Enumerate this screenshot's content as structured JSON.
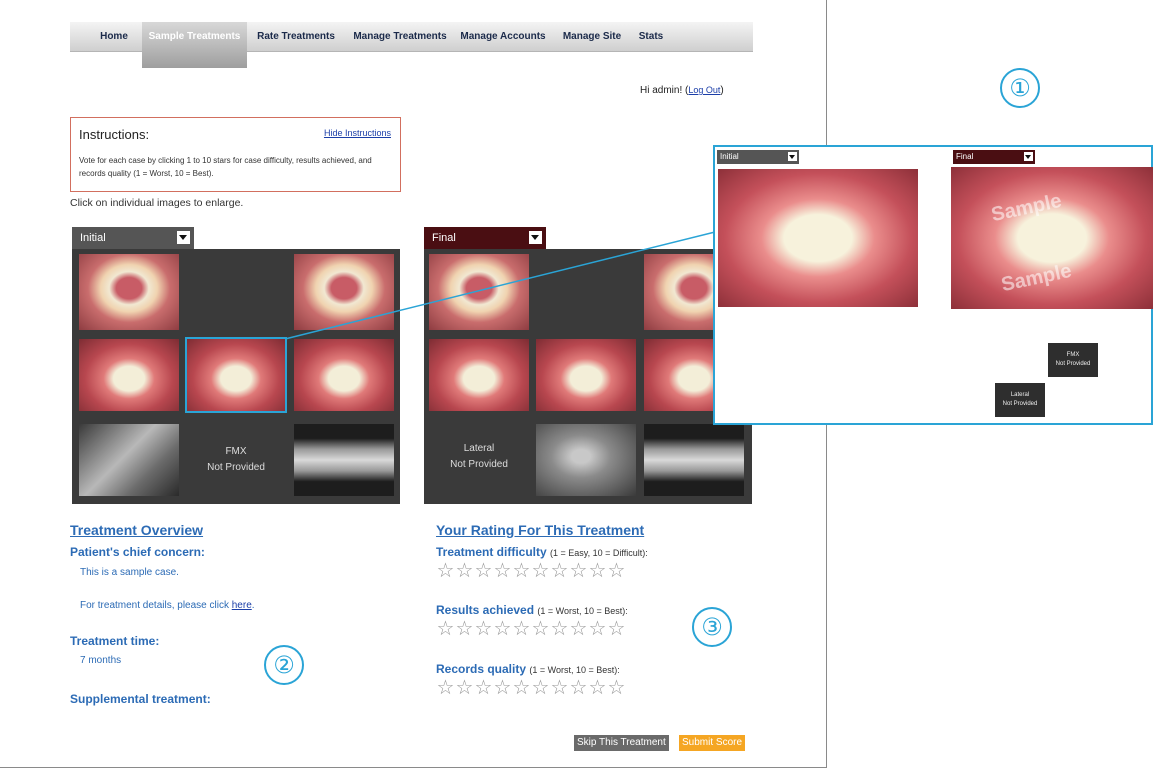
{
  "nav": {
    "items": [
      {
        "label": "Home",
        "active": false
      },
      {
        "label": "Sample Treatments",
        "active": true
      },
      {
        "label": "Rate Treatments",
        "active": false
      },
      {
        "label": "Manage Treatments",
        "active": false
      },
      {
        "label": "Manage Accounts",
        "active": false
      },
      {
        "label": "Manage Site",
        "active": false
      },
      {
        "label": "Stats",
        "active": false
      }
    ]
  },
  "greeting": {
    "text": "Hi admin! (",
    "logout": "Log Out",
    "close": ")"
  },
  "instructions": {
    "title": "Instructions:",
    "hide_link": "Hide Instructions",
    "text": "Vote for each case by clicking 1 to 10 stars for case difficulty, results achieved, and records quality (1 = Worst, 10 = Best)."
  },
  "click_hint": "Click on individual images to enlarge.",
  "panels": {
    "initial": {
      "label": "Initial",
      "color": "#555555",
      "fmx": "FMX",
      "fmx_status": "Not Provided"
    },
    "final": {
      "label": "Final",
      "color": "#4a0e12",
      "lateral": "Lateral",
      "lateral_status": "Not Provided"
    }
  },
  "overview": {
    "heading": "Treatment Overview",
    "concern_label": "Patient's chief concern:",
    "concern_text": "This is a sample case.",
    "details_text": "For treatment details, please click ",
    "details_link": "here",
    "details_end": ".",
    "time_label": "Treatment time:",
    "time_value": "7 months",
    "supplemental_label": "Supplemental treatment:"
  },
  "rating": {
    "heading": "Your Rating For This Treatment",
    "difficulty_label": "Treatment difficulty",
    "difficulty_scale": "(1 = Easy, 10 = Difficult):",
    "results_label": "Results achieved",
    "results_scale": "(1 = Worst, 10 = Best):",
    "records_label": "Records quality",
    "records_scale": "(1 = Worst, 10 = Best):",
    "star_count": 10
  },
  "buttons": {
    "skip": "Skip This Treatment",
    "submit": "Submit Score"
  },
  "callouts": {
    "one": "①",
    "two": "②",
    "three": "③"
  },
  "zoom": {
    "initial_label": "Initial",
    "final_label": "Final",
    "watermark": "Sample",
    "fmx": "FMX",
    "fmx_status": "Not Provided",
    "lateral": "Lateral",
    "lateral_status": "Not Provided"
  },
  "colors": {
    "accent": "#2aa4d6",
    "heading": "#2c6bb5",
    "submit": "#f5a623",
    "skip": "#6a6a6a"
  }
}
